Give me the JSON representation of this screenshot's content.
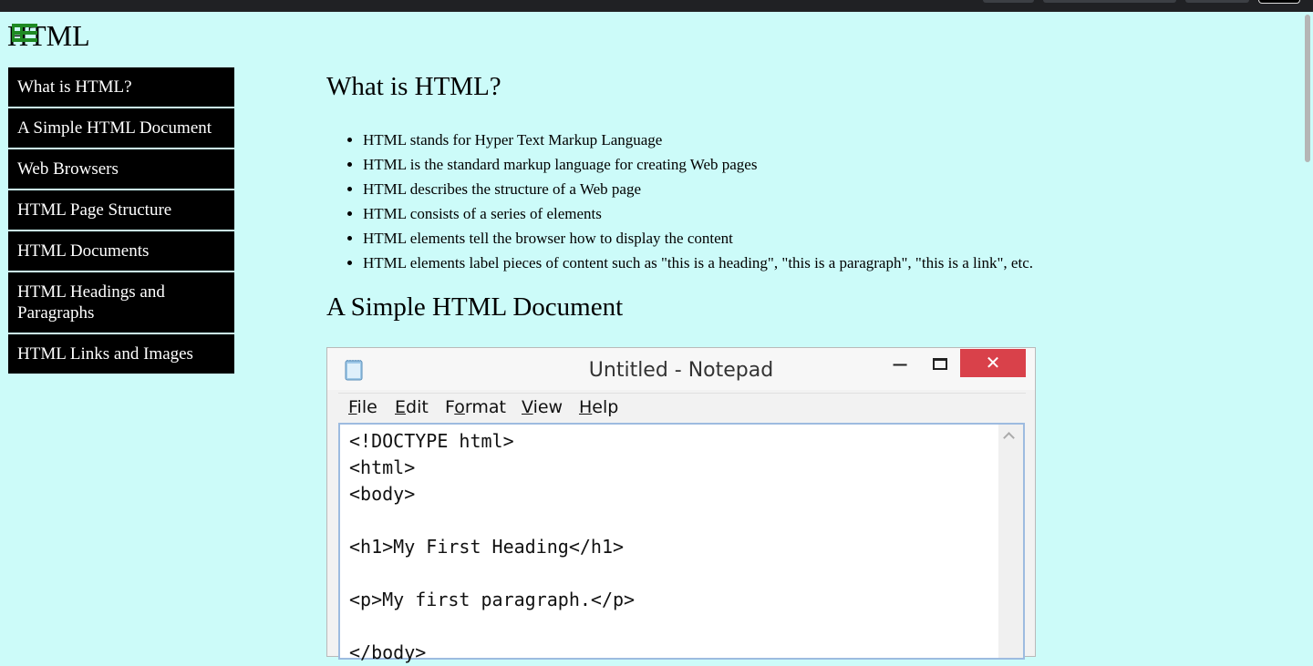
{
  "site": {
    "title": "HTML"
  },
  "icons": {
    "menu": "menu-table-icon",
    "notepad": "notepad-app-icon"
  },
  "colors": {
    "page_bg": "#ccfbf9",
    "nav_bg": "#000000",
    "nav_text": "#ffffff",
    "icon_green": "#1e8a23",
    "close_red": "#d9414a"
  },
  "sidebar": {
    "items": [
      {
        "label": "What is HTML?"
      },
      {
        "label": "A Simple HTML Document"
      },
      {
        "label": "Web Browsers"
      },
      {
        "label": "HTML Page Structure"
      },
      {
        "label": "HTML Documents"
      },
      {
        "label": "HTML Headings and Paragraphs"
      },
      {
        "label": "HTML Links and Images"
      }
    ]
  },
  "main": {
    "section1": {
      "heading": "What is HTML?",
      "bullets": [
        "HTML stands for Hyper Text Markup Language",
        "HTML is the standard markup language for creating Web pages",
        "HTML describes the structure of a Web page",
        "HTML consists of a series of elements",
        "HTML elements tell the browser how to display the content",
        "HTML elements label pieces of content such as \"this is a heading\", \"this is a paragraph\", \"this is a link\", etc."
      ]
    },
    "section2": {
      "heading": "A Simple HTML Document"
    }
  },
  "notepad": {
    "title": "Untitled - Notepad",
    "minimize": "−",
    "close": "✕",
    "menu": [
      {
        "first": "F",
        "rest": "ile"
      },
      {
        "first": "E",
        "rest": "dit"
      },
      {
        "pre": "F",
        "first": "o",
        "rest": "rmat"
      },
      {
        "first": "V",
        "rest": "iew"
      },
      {
        "first": "H",
        "rest": "elp"
      }
    ],
    "code": "<!DOCTYPE html>\n<html>\n<body>\n\n<h1>My First Heading</h1>\n\n<p>My first paragraph.</p>\n\n</body>"
  }
}
